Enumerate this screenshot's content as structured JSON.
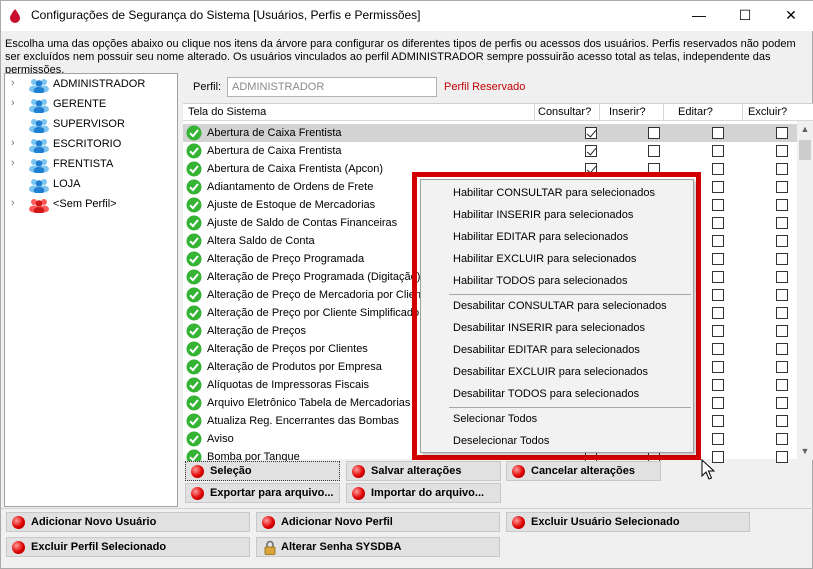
{
  "window": {
    "title": "Configurações de Segurança do Sistema [Usuários, Perfis e Permissões]",
    "minimize": "—",
    "maximize": "☐",
    "close": "✕"
  },
  "description": "Escolha uma das opções abaixo ou clique nos itens da árvore para configurar os diferentes tipos de perfis ou acessos dos usuários. Perfis reservados não podem ser excluídos nem possuir seu nome alterado. Os usuários vinculados ao perfil ADMINISTRADOR sempre possuirão acesso total as telas, independente das permissões.",
  "tree": {
    "items": [
      {
        "label": "ADMINISTRADOR",
        "chevron": "›",
        "color": "blue"
      },
      {
        "label": "GERENTE",
        "chevron": "›",
        "color": "blue"
      },
      {
        "label": "SUPERVISOR",
        "chevron": "",
        "color": "blue"
      },
      {
        "label": "ESCRITORIO",
        "chevron": "›",
        "color": "blue"
      },
      {
        "label": "FRENTISTA",
        "chevron": "›",
        "color": "blue"
      },
      {
        "label": "LOJA",
        "chevron": "",
        "color": "blue"
      },
      {
        "label": "<Sem Perfil>",
        "chevron": "›",
        "color": "red"
      }
    ]
  },
  "profile": {
    "label": "Perfil:",
    "value": "ADMINISTRADOR",
    "reserved_label": "Perfil Reservado"
  },
  "grid": {
    "columns": {
      "screen": "Tela do Sistema",
      "consult": "Consultar?",
      "insert": "Inserir?",
      "edit": "Editar?",
      "delete": "Excluir?"
    },
    "rows": [
      {
        "name": "Abertura de Caixa Frentista",
        "consult": true,
        "insert": false,
        "edit": false,
        "delete": false,
        "selected": true
      },
      {
        "name": "Abertura de Caixa Frentista",
        "consult": true,
        "insert": false,
        "edit": false,
        "delete": false,
        "selected": false
      },
      {
        "name": "Abertura de Caixa Frentista (Apcon)",
        "consult": true,
        "insert": false,
        "edit": false,
        "delete": false,
        "selected": false
      },
      {
        "name": "Adiantamento de Ordens de Frete",
        "consult": false,
        "insert": false,
        "edit": false,
        "delete": false,
        "selected": false
      },
      {
        "name": "Ajuste de Estoque de Mercadorias",
        "consult": false,
        "insert": false,
        "edit": false,
        "delete": false,
        "selected": false
      },
      {
        "name": "Ajuste de Saldo de Contas Financeiras",
        "consult": false,
        "insert": false,
        "edit": false,
        "delete": false,
        "selected": false
      },
      {
        "name": "Altera Saldo de Conta",
        "consult": false,
        "insert": false,
        "edit": false,
        "delete": false,
        "selected": false
      },
      {
        "name": "Alteração de Preço Programada",
        "consult": false,
        "insert": false,
        "edit": false,
        "delete": false,
        "selected": false
      },
      {
        "name": "Alteração de Preço Programada (Digitação)",
        "consult": false,
        "insert": false,
        "edit": false,
        "delete": false,
        "selected": false
      },
      {
        "name": "Alteração de Preço de Mercadoria por Cliente",
        "consult": false,
        "insert": false,
        "edit": false,
        "delete": false,
        "selected": false
      },
      {
        "name": "Alteração de Preço por Cliente Simplificado",
        "consult": false,
        "insert": false,
        "edit": false,
        "delete": false,
        "selected": false
      },
      {
        "name": "Alteração de Preços",
        "consult": false,
        "insert": false,
        "edit": false,
        "delete": false,
        "selected": false
      },
      {
        "name": "Alteração de Preços por Clientes",
        "consult": false,
        "insert": false,
        "edit": false,
        "delete": false,
        "selected": false
      },
      {
        "name": "Alteração de Produtos por Empresa",
        "consult": false,
        "insert": false,
        "edit": false,
        "delete": false,
        "selected": false
      },
      {
        "name": "Alíquotas de Impressoras Fiscais",
        "consult": false,
        "insert": false,
        "edit": false,
        "delete": false,
        "selected": false
      },
      {
        "name": "Arquivo Eletrônico Tabela de Mercadorias",
        "consult": false,
        "insert": false,
        "edit": false,
        "delete": false,
        "selected": false
      },
      {
        "name": "Atualiza Reg. Encerrantes das Bombas",
        "consult": false,
        "insert": false,
        "edit": false,
        "delete": false,
        "selected": false
      },
      {
        "name": "Aviso",
        "consult": false,
        "insert": false,
        "edit": false,
        "delete": false,
        "selected": false
      },
      {
        "name": "Bomba por Tanque",
        "consult": false,
        "insert": false,
        "edit": false,
        "delete": false,
        "selected": false
      }
    ]
  },
  "scroll": {
    "up": "▲",
    "down": "▼"
  },
  "context_menu": {
    "items": [
      "Habilitar CONSULTAR para selecionados",
      "Habilitar INSERIR para selecionados",
      "Habilitar EDITAR para selecionados",
      "Habilitar EXCLUIR para selecionados",
      "Habilitar TODOS para selecionados",
      "Desabilitar CONSULTAR para selecionados",
      "Desabilitar INSERIR para selecionados",
      "Desabilitar EDITAR para selecionados",
      "Desabilitar EXCLUIR para selecionados",
      "Desabilitar TODOS para selecionados",
      "Selecionar Todos",
      "Deselecionar Todos"
    ]
  },
  "actions": {
    "selection": "Seleção",
    "save": "Salvar alterações",
    "cancel": "Cancelar alterações",
    "export": "Exportar para arquivo...",
    "import": "Importar do arquivo..."
  },
  "footer": {
    "add_user": "Adicionar Novo Usuário",
    "add_profile": "Adicionar Novo Perfil",
    "delete_user": "Excluir Usuário Selecionado",
    "delete_profile": "Excluir Perfil Selecionado",
    "change_password": "Alterar Senha SYSDBA"
  },
  "colors": {
    "highlight": "#d40000",
    "reserved": "#c00000",
    "check_ok": "#2faa2f"
  }
}
